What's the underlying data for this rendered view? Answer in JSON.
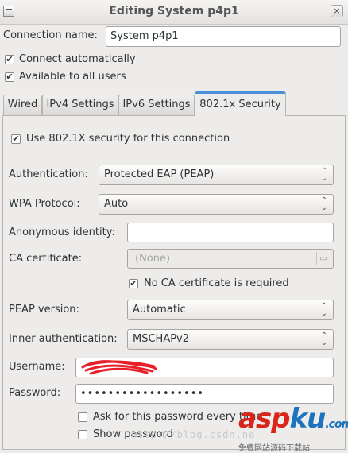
{
  "window": {
    "title": "Editing System p4p1",
    "close_glyph": "×"
  },
  "connection": {
    "name_label": "Connection name:",
    "name_value": "System p4p1",
    "auto_connect_label": "Connect automatically",
    "auto_connect_checked": true,
    "all_users_label": "Available to all users",
    "all_users_checked": true
  },
  "tabs": [
    {
      "label": "Wired",
      "active": false
    },
    {
      "label": "IPv4 Settings",
      "active": false
    },
    {
      "label": "IPv6 Settings",
      "active": false
    },
    {
      "label": "802.1x Security",
      "active": true
    }
  ],
  "security": {
    "use_8021x_label": "Use 802.1X security for this connection",
    "use_8021x_checked": true,
    "authentication_label": "Authentication:",
    "authentication_value": "Protected EAP (PEAP)",
    "wpa_protocol_label": "WPA Protocol:",
    "wpa_protocol_value": "Auto",
    "anon_identity_label": "Anonymous identity:",
    "anon_identity_value": "",
    "ca_cert_label": "CA certificate:",
    "ca_cert_value": "(None)",
    "no_ca_label": "No CA certificate is required",
    "no_ca_checked": true,
    "peap_version_label": "PEAP version:",
    "peap_version_value": "Automatic",
    "inner_auth_label": "Inner authentication:",
    "inner_auth_value": "MSCHAPv2",
    "username_label": "Username:",
    "password_label": "Password:",
    "password_value": "••••••••••••••••••",
    "ask_password_label": "Ask for this password every time",
    "ask_password_checked": false,
    "show_password_label": "Show password",
    "show_password_checked": false
  },
  "icons": {
    "check": "✔",
    "combo_arrows": "⌃⌄",
    "folder": "folder-icon"
  },
  "overlay": {
    "watermark_text": "http://blog.csdn.ne",
    "logo_text": "aspku.com",
    "logo_sub": "免费网站源码下载站"
  },
  "colors": {
    "accent": "#4a90d9",
    "scribble": "#e8202a",
    "logo_red": "#d9261c",
    "logo_blue": "#1e73be"
  }
}
